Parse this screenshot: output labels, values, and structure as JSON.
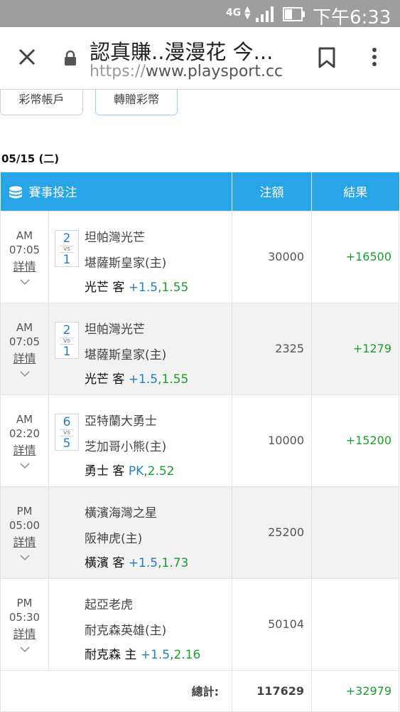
{
  "status_bar": {
    "network": "4G",
    "time": "下午6:33"
  },
  "browser": {
    "page_title": "認真賺..漫漫花 今...",
    "url_scheme": "https://",
    "url_host": "www.playsport.cc"
  },
  "actions": {
    "account": "彩幣帳戶",
    "transfer": "轉贈彩幣"
  },
  "date": "05/15 (二)",
  "table": {
    "headers": {
      "bet": "賽事投注",
      "amount": "注額",
      "result": "結果"
    },
    "detail_label": "詳情",
    "vs_label": "vs",
    "rows": [
      {
        "ampm": "AM",
        "time": "07:05",
        "score_away": "2",
        "score_home": "1",
        "away": "坦帕灣光芒",
        "home": "堪薩斯皇家(主)",
        "pick": "光芒 客",
        "spread": "+1.5",
        "odds": ",1.55",
        "amount": "30000",
        "result": "+16500"
      },
      {
        "ampm": "AM",
        "time": "07:05",
        "score_away": "2",
        "score_home": "1",
        "away": "坦帕灣光芒",
        "home": "堪薩斯皇家(主)",
        "pick": "光芒 客",
        "spread": "+1.5",
        "odds": ",1.55",
        "amount": "2325",
        "result": "+1279"
      },
      {
        "ampm": "AM",
        "time": "02:20",
        "score_away": "6",
        "score_home": "5",
        "away": "亞特蘭大勇士",
        "home": "芝加哥小熊(主)",
        "pick": "勇士 客",
        "spread": "PK",
        "odds": ",2.52",
        "amount": "10000",
        "result": "+15200"
      },
      {
        "ampm": "PM",
        "time": "05:00",
        "away": "橫濱海灣之星",
        "home": "阪神虎(主)",
        "pick": "橫濱 客",
        "spread": "+1.5",
        "odds": ",1.73",
        "amount": "25200",
        "result": ""
      },
      {
        "ampm": "PM",
        "time": "05:30",
        "away": "起亞老虎",
        "home": "耐克森英雄(主)",
        "pick": "耐克森 主",
        "spread": "+1.5",
        "odds": ",2.16",
        "amount": "50104",
        "result": ""
      }
    ],
    "total": {
      "label": "總計:",
      "amount": "117629",
      "result": "+32979"
    }
  },
  "colors": {
    "header_blue": "#28a5e9",
    "win_green": "#1a9e2e",
    "spread_blue": "#1e7fc8"
  }
}
